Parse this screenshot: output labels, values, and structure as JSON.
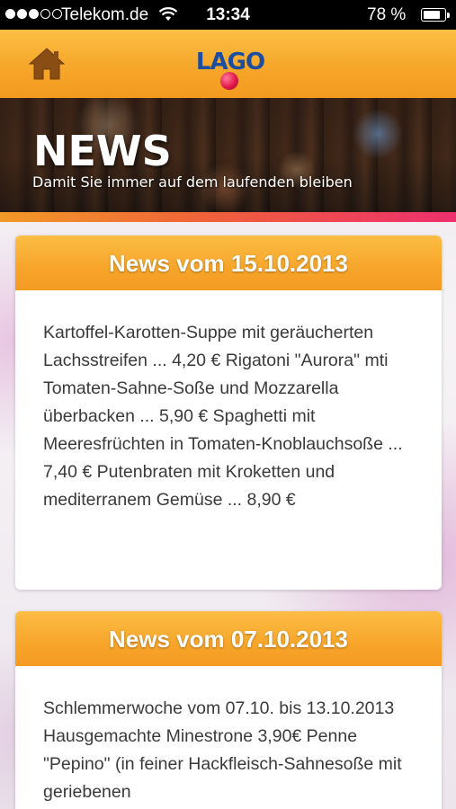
{
  "status_bar": {
    "carrier": "Telekom.de",
    "time": "13:34",
    "battery": "78 %",
    "battery_level": 0.78
  },
  "app_bar": {
    "logo_text": "LAGO"
  },
  "banner": {
    "title": "NEWS",
    "subtitle": "Damit Sie immer auf dem laufenden bleiben"
  },
  "news": [
    {
      "title": "News vom 15.10.2013",
      "body": "Kartoffel-Karotten-Suppe mit geräucherten Lachsstreifen ... 4,20 € Rigatoni \"Aurora\" mti Tomaten-Sahne-Soße und Mozzarella überbacken ... 5,90 € Spaghetti mit Meeresfrüchten in Tomaten-Knoblauchsoße ... 7,40 € Putenbraten mit Kroketten und mediterranem Gemüse ... 8,90 €"
    },
    {
      "title": "News vom 07.10.2013",
      "body": "Schlemmerwoche vom 07.10. bis 13.10.2013 Hausgemachte Minestrone 3,90€ Penne \"Pepino\" (in feiner Hackfleisch-Sahnesoße mit geriebenen"
    }
  ],
  "colors": {
    "accent": "#f6a72a",
    "logo_blue": "#1d4e9e",
    "stripe_end": "#ee2f6e"
  },
  "icons": {
    "home": "home-icon",
    "wifi": "wifi-icon"
  }
}
